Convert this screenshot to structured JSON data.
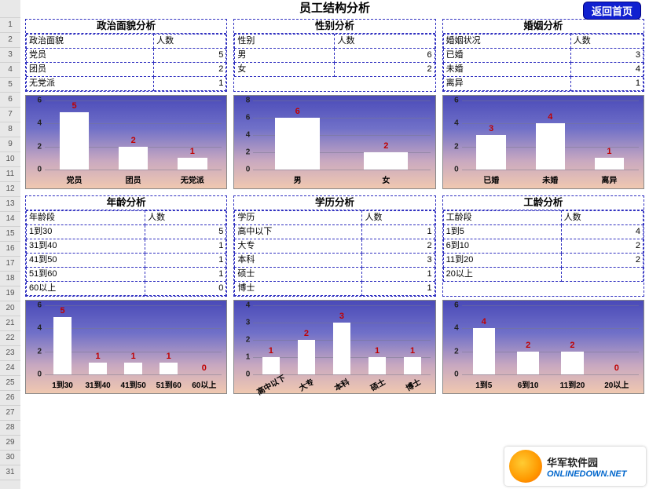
{
  "title": "员工结构分析",
  "home_button": "返回首页",
  "row_numbers": [
    "",
    "1",
    "2",
    "3",
    "4",
    "5",
    "6",
    "7",
    "8",
    "9",
    "10",
    "11",
    "12",
    "13",
    "14",
    "15",
    "16",
    "17",
    "18",
    "19",
    "20",
    "21",
    "22",
    "23",
    "24",
    "25",
    "26",
    "27",
    "28",
    "29",
    "30",
    "31"
  ],
  "panels_top": [
    {
      "title": "政治面貌分析",
      "col1": "政治面貌",
      "col2": "人数",
      "rows": [
        {
          "k": "党员",
          "v": 5
        },
        {
          "k": "团员",
          "v": 2
        },
        {
          "k": "无党派",
          "v": 1
        }
      ]
    },
    {
      "title": "性别分析",
      "col1": "性别",
      "col2": "人数",
      "rows": [
        {
          "k": "男",
          "v": 6
        },
        {
          "k": "女",
          "v": 2
        }
      ]
    },
    {
      "title": "婚姻分析",
      "col1": "婚姻状况",
      "col2": "人数",
      "rows": [
        {
          "k": "已婚",
          "v": 3
        },
        {
          "k": "未婚",
          "v": 4
        },
        {
          "k": "离异",
          "v": 1
        }
      ]
    }
  ],
  "panels_bottom": [
    {
      "title": "年龄分析",
      "col1": "年龄段",
      "col2": "人数",
      "rows": [
        {
          "k": "1到30",
          "v": 5
        },
        {
          "k": "31到40",
          "v": 1
        },
        {
          "k": "41到50",
          "v": 1
        },
        {
          "k": "51到60",
          "v": 1
        },
        {
          "k": "60以上",
          "v": 0
        }
      ]
    },
    {
      "title": "学历分析",
      "col1": "学历",
      "col2": "人数",
      "rows": [
        {
          "k": "高中以下",
          "v": 1
        },
        {
          "k": "大专",
          "v": 2
        },
        {
          "k": "本科",
          "v": 3
        },
        {
          "k": "硕士",
          "v": 1
        },
        {
          "k": "博士",
          "v": 1
        }
      ]
    },
    {
      "title": "工龄分析",
      "col1": "工龄段",
      "col2": "人数",
      "rows": [
        {
          "k": "1到5",
          "v": 4
        },
        {
          "k": "6到10",
          "v": 2
        },
        {
          "k": "11到20",
          "v": 2
        },
        {
          "k": "20以上",
          "v": ""
        }
      ]
    }
  ],
  "chart_data": [
    {
      "type": "bar",
      "categories": [
        "党员",
        "团员",
        "无党派"
      ],
      "values": [
        5,
        2,
        1
      ],
      "ylim": [
        0,
        6
      ],
      "ystep": 2
    },
    {
      "type": "bar",
      "categories": [
        "男",
        "女"
      ],
      "values": [
        6,
        2
      ],
      "ylim": [
        0,
        8
      ],
      "ystep": 2
    },
    {
      "type": "bar",
      "categories": [
        "已婚",
        "未婚",
        "离异"
      ],
      "values": [
        3,
        4,
        1
      ],
      "ylim": [
        0,
        6
      ],
      "ystep": 2
    },
    {
      "type": "bar",
      "categories": [
        "1到30",
        "31到40",
        "41到50",
        "51到60",
        "60以上"
      ],
      "values": [
        5,
        1,
        1,
        1,
        0
      ],
      "ylim": [
        0,
        6
      ],
      "ystep": 2
    },
    {
      "type": "bar",
      "categories": [
        "高中以下",
        "大专",
        "本科",
        "硕士",
        "博士"
      ],
      "values": [
        1,
        2,
        3,
        1,
        1
      ],
      "ylim": [
        0,
        4
      ],
      "ystep": 1,
      "rot": true
    },
    {
      "type": "bar",
      "categories": [
        "1到5",
        "6到10",
        "11到20",
        "20以上"
      ],
      "values": [
        4,
        2,
        2,
        0
      ],
      "ylim": [
        0,
        6
      ],
      "ystep": 2
    }
  ],
  "watermark": {
    "line1": "华军软件园",
    "line2": "ONLINEDOWN.NET"
  }
}
